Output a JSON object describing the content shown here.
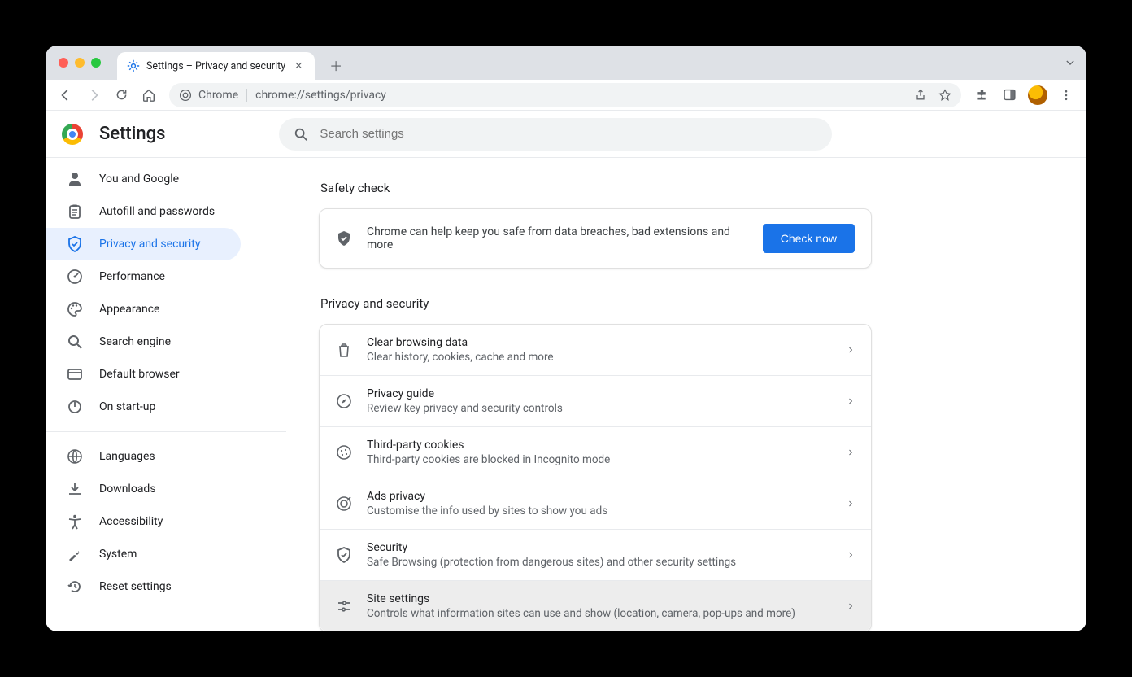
{
  "window": {
    "traffic_colors": [
      "#ff5f57",
      "#febc2e",
      "#28c840"
    ]
  },
  "tab": {
    "title": "Settings – Privacy and security"
  },
  "omnibox": {
    "chip_label": "Chrome",
    "url": "chrome://settings/privacy"
  },
  "header": {
    "title": "Settings",
    "search_placeholder": "Search settings"
  },
  "sidebar": {
    "group1": [
      {
        "label": "You and Google",
        "icon": "person"
      },
      {
        "label": "Autofill and passwords",
        "icon": "clipboard"
      },
      {
        "label": "Privacy and security",
        "icon": "shield",
        "active": true
      },
      {
        "label": "Performance",
        "icon": "speedometer"
      },
      {
        "label": "Appearance",
        "icon": "palette"
      },
      {
        "label": "Search engine",
        "icon": "search"
      },
      {
        "label": "Default browser",
        "icon": "window"
      },
      {
        "label": "On start-up",
        "icon": "power"
      }
    ],
    "group2": [
      {
        "label": "Languages",
        "icon": "globe"
      },
      {
        "label": "Downloads",
        "icon": "download"
      },
      {
        "label": "Accessibility",
        "icon": "accessibility"
      },
      {
        "label": "System",
        "icon": "wrench"
      },
      {
        "label": "Reset settings",
        "icon": "restore"
      }
    ]
  },
  "sections": {
    "safety_title": "Safety check",
    "privacy_title": "Privacy and security"
  },
  "safety": {
    "text": "Chrome can help keep you safe from data breaches, bad extensions and more",
    "button": "Check now"
  },
  "rows": [
    {
      "title": "Clear browsing data",
      "sub": "Clear history, cookies, cache and more",
      "icon": "trash"
    },
    {
      "title": "Privacy guide",
      "sub": "Review key privacy and security controls",
      "icon": "compass"
    },
    {
      "title": "Third-party cookies",
      "sub": "Third-party cookies are blocked in Incognito mode",
      "icon": "cookie"
    },
    {
      "title": "Ads privacy",
      "sub": "Customise the info used by sites to show you ads",
      "icon": "target"
    },
    {
      "title": "Security",
      "sub": "Safe Browsing (protection from dangerous sites) and other security settings",
      "icon": "shield"
    },
    {
      "title": "Site settings",
      "sub": "Controls what information sites can use and show (location, camera, pop-ups and more)",
      "icon": "tune",
      "hovered": true
    }
  ]
}
